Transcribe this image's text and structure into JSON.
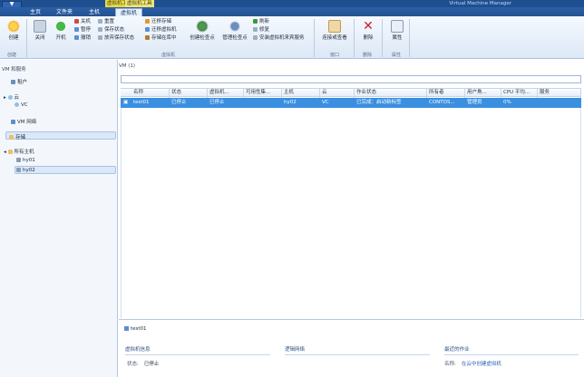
{
  "titlebar": {
    "ctx_tab_a": "虚拟机工具",
    "ctx_tab_b": "虚拟机工具",
    "title": "Virtual Machine Manager"
  },
  "tabs": [
    {
      "label": "主页"
    },
    {
      "label": "文件夹"
    },
    {
      "label": "主机"
    },
    {
      "label": "虚拟机"
    }
  ],
  "ribbon": {
    "create": "创建",
    "shutdown": "关闭",
    "start": "开机",
    "power_off": "关机",
    "pause": "暂停",
    "shutdown_small": "撤销",
    "reset": "重置",
    "save_state": "保存状态",
    "discard_saved": "放弃保存状态",
    "migrate_storage": "迁移存储",
    "migrate_vm": "迁移虚拟机",
    "store_in_library": "存储在库中",
    "create_checkpoint": "创建检查点",
    "manage_checkpoint": "管理检查点",
    "refresh": "刷新",
    "repair": "修复",
    "install_vm_guest": "安装虚拟机来宾服务",
    "connect_view": "连接或查看",
    "delete": "删除",
    "properties": "属性",
    "grp_create": "创建",
    "grp_vm": "虚拟机",
    "grp_window": "窗口",
    "grp_delete": "删除",
    "grp_properties": "属性"
  },
  "nav": {
    "header": "VM 和服务",
    "tenants": "租户",
    "clouds": "云",
    "vc": "VC",
    "vm_networks": "VM 网络",
    "storage": "存储",
    "all_hosts": "所有主机",
    "hy01": "hy01",
    "hy02": "hy02"
  },
  "main": {
    "header": "VM (1)",
    "columns": [
      "名称",
      "状态",
      "虚拟机...",
      "可用性集...",
      "主机",
      "云",
      "作业状态",
      "所有者",
      "用户角...",
      "CPU 平均...",
      "服务"
    ],
    "rows": [
      [
        "test01",
        "已停止",
        "已停止",
        "",
        "hy02",
        "VC",
        "已完成：启动新标签",
        "CONTOS...",
        "管理员",
        "0%",
        ""
      ]
    ]
  },
  "details": {
    "tab": "test01",
    "vm_info": "虚拟机信息",
    "network": "逻辑网络",
    "recent_job": "最近的作业",
    "status_k": "状态:",
    "status_v": "已停止",
    "name_k": "名称:",
    "name_v": "在云中创建虚拟机"
  },
  "colors": {
    "accent": "#3a8fe0",
    "titlebar": "#1f4f8f"
  }
}
